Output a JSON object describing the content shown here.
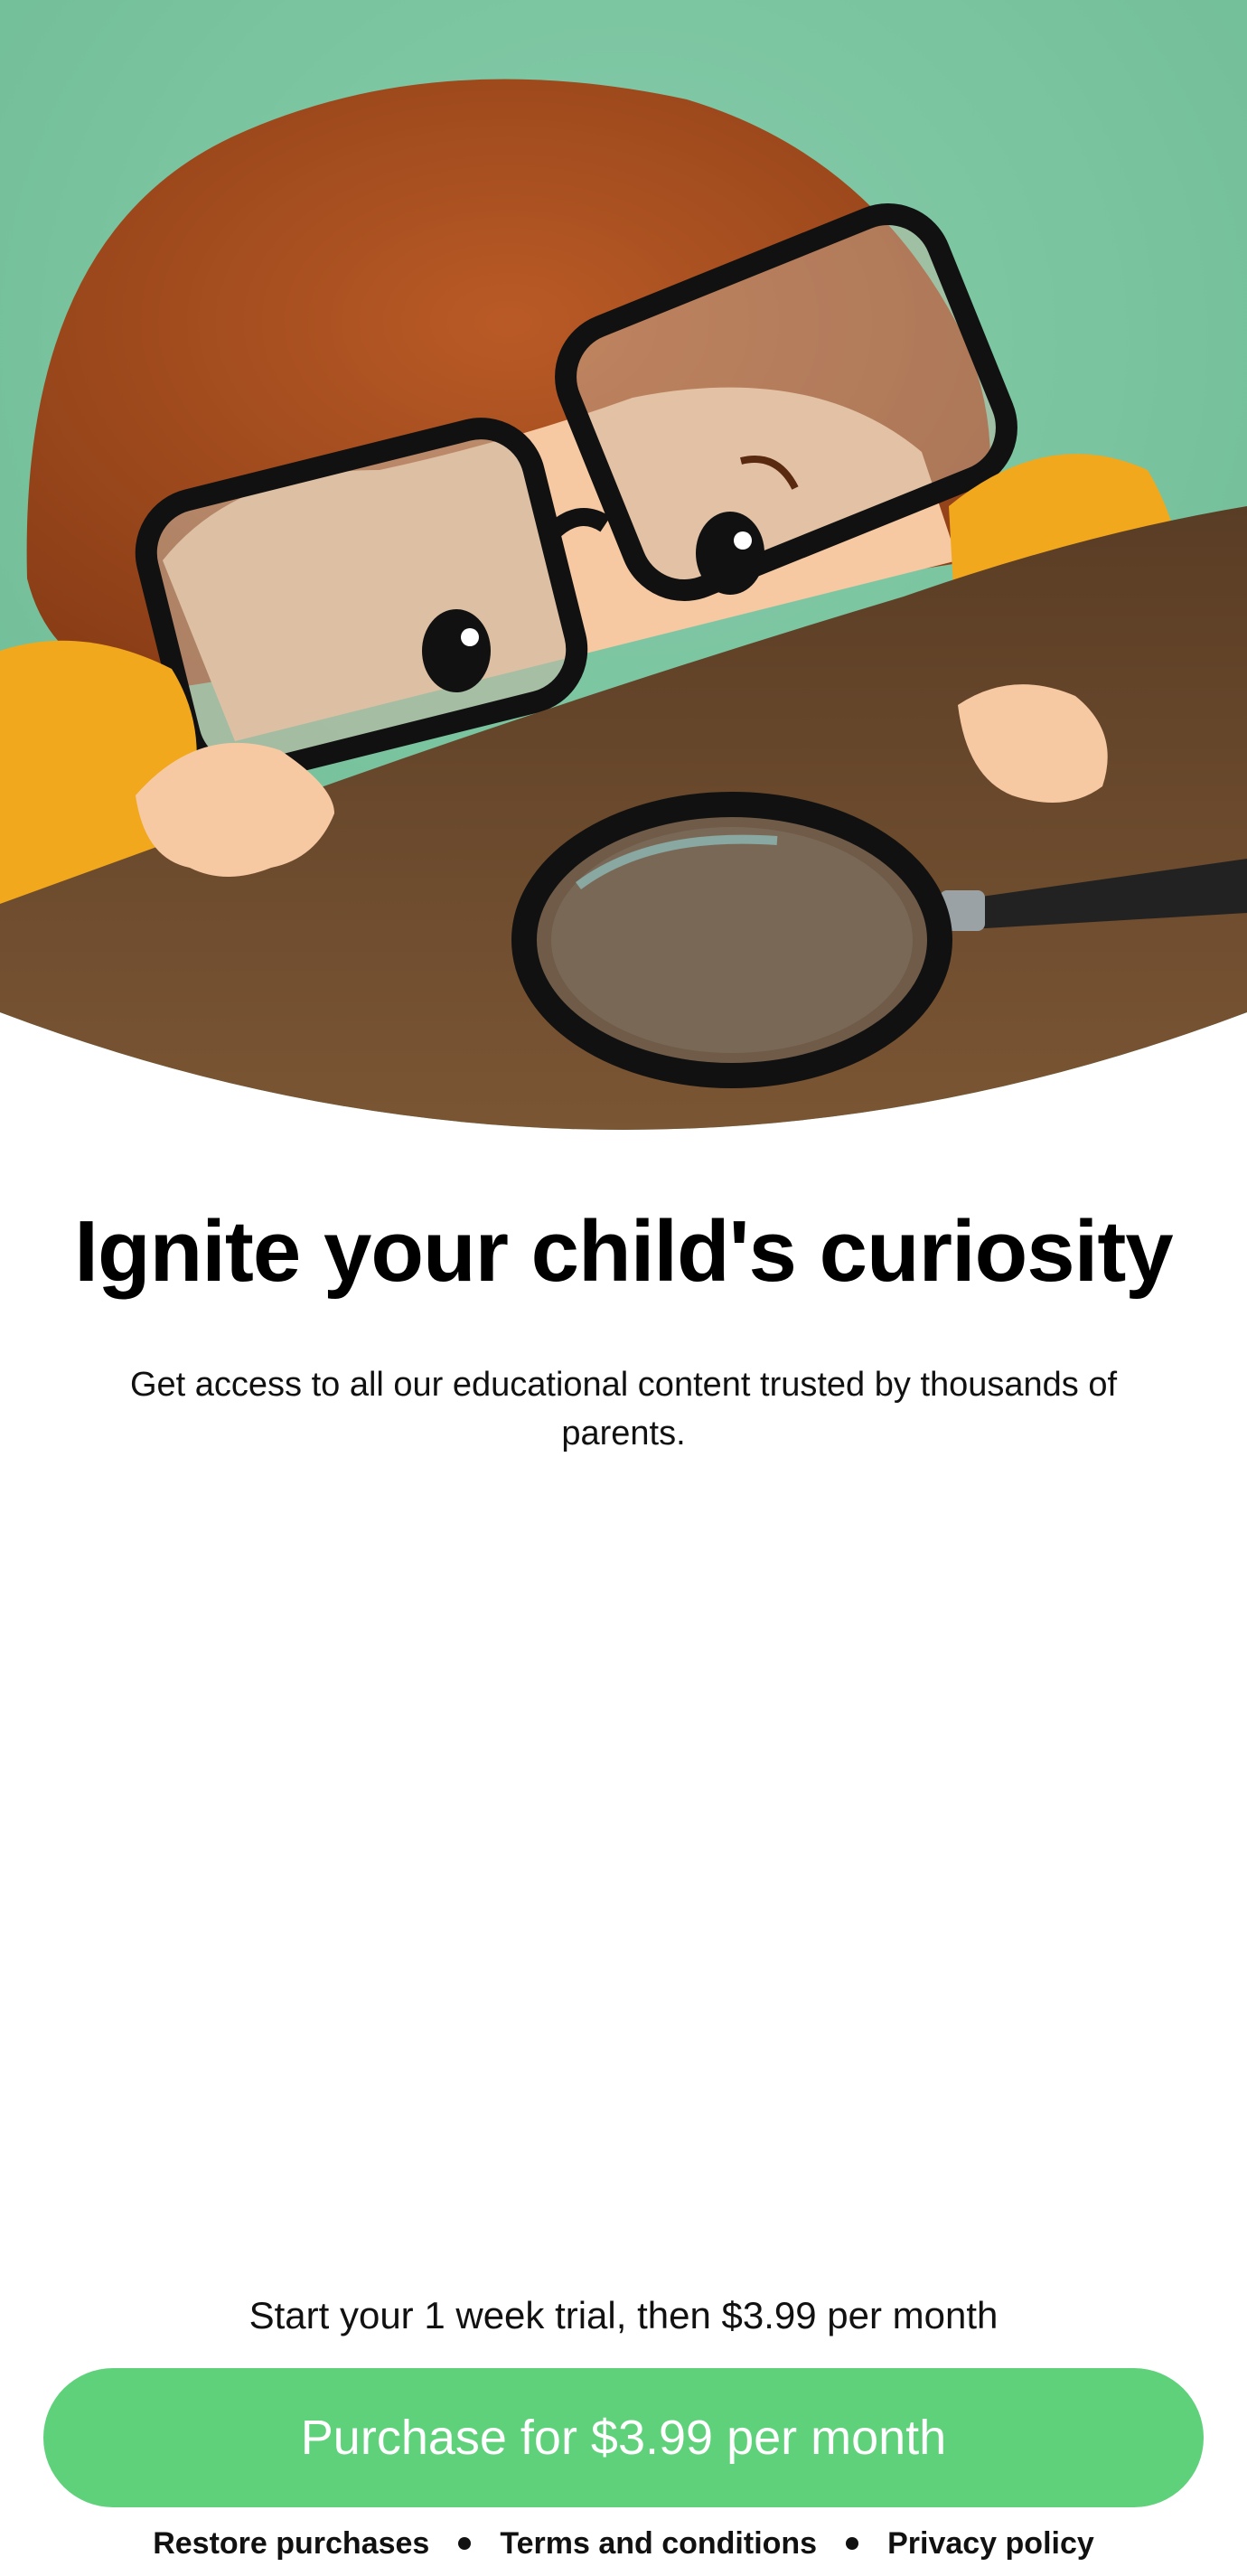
{
  "hero": {
    "illustration": "child-with-glasses-and-magnifying-glass",
    "colors": {
      "background": "#7cc4a0",
      "hair": "#a34a1c",
      "sleeve": "#f2a81d",
      "table": "#6b4a2c",
      "skin": "#f6c9a3"
    }
  },
  "headline": "Ignite your child's curiosity",
  "subtitle": "Get access to all our educational content trusted by thousands of parents.",
  "trial_text": "Start your 1 week trial, then $3.99 per month",
  "purchase": {
    "label": "Purchase for $3.99 per month",
    "color": "#5ed17a"
  },
  "footer": {
    "restore_label": "Restore purchases",
    "terms_label": "Terms and conditions",
    "privacy_label": "Privacy policy"
  }
}
